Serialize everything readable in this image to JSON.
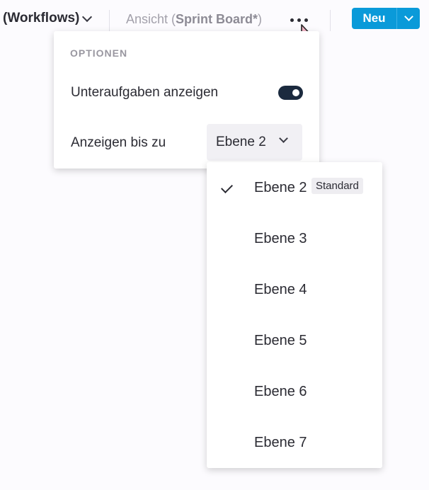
{
  "topbar": {
    "workflows_label": "(Workflows)",
    "view_prefix": "Ansicht (",
    "view_name": "Sprint Board*",
    "view_suffix": ")",
    "new_button_label": "Neu"
  },
  "options_menu": {
    "heading": "OPTIONEN",
    "show_subtasks_label": "Unteraufgaben anzeigen",
    "show_subtasks_enabled": true,
    "show_up_to_label": "Anzeigen bis zu",
    "level_selected": "Ebene 2"
  },
  "level_dropdown": {
    "items": [
      {
        "label": "Ebene 2",
        "selected": true,
        "badge": "Standard"
      },
      {
        "label": "Ebene 3",
        "selected": false
      },
      {
        "label": "Ebene 4",
        "selected": false
      },
      {
        "label": "Ebene 5",
        "selected": false
      },
      {
        "label": "Ebene 6",
        "selected": false
      },
      {
        "label": "Ebene 7",
        "selected": false
      }
    ]
  },
  "colors": {
    "accent": "#0a9ad9",
    "toggle_on": "#1b2a3e"
  }
}
